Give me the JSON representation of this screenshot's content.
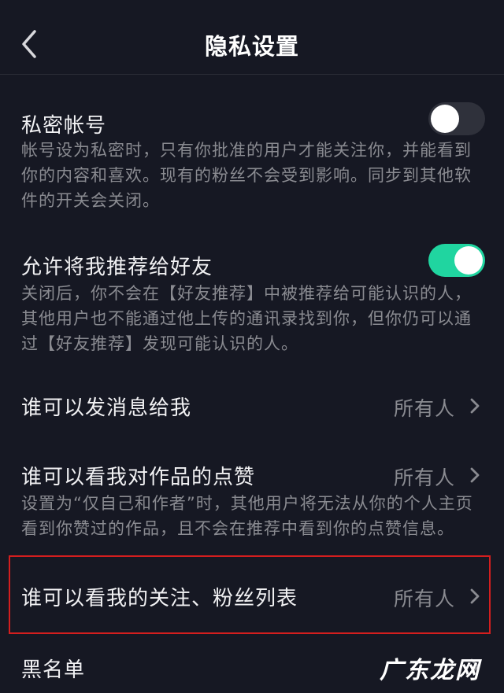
{
  "header": {
    "title": "隐私设置",
    "back_icon": "chevron-left-icon"
  },
  "settings": {
    "private_account": {
      "title": "私密帐号",
      "description": "帐号设为私密时，只有你批准的用户才能关注你，并能看到你的内容和喜欢。现有的粉丝不会受到影响。同步到其他软件的开关会关闭。",
      "enabled": false
    },
    "recommend_to_friends": {
      "title": "允许将我推荐给好友",
      "description": "关闭后，你不会在【好友推荐】中被推荐给可能认识的人，其他用户也不能通过他上传的通讯录找到你，但你仍可以通过【好友推荐】发现可能认识的人。",
      "enabled": true
    },
    "who_can_message": {
      "title": "谁可以发消息给我",
      "value": "所有人"
    },
    "who_can_see_likes": {
      "title": "谁可以看我对作品的点赞",
      "value": "所有人",
      "description": "设置为“仅自己和作者”时，其他用户将无法从你的个人主页看到你赞过的作品，且不会在推荐中看到你的点赞信息。"
    },
    "who_can_see_follow_list": {
      "title": "谁可以看我的关注、粉丝列表",
      "value": "所有人"
    },
    "blacklist": {
      "title": "黑名单"
    }
  },
  "watermark": "广东龙网",
  "colors": {
    "background": "#161823",
    "toggle_on": "#20d5a0",
    "toggle_off": "#2f313b",
    "highlight_border": "#d41e1e"
  }
}
